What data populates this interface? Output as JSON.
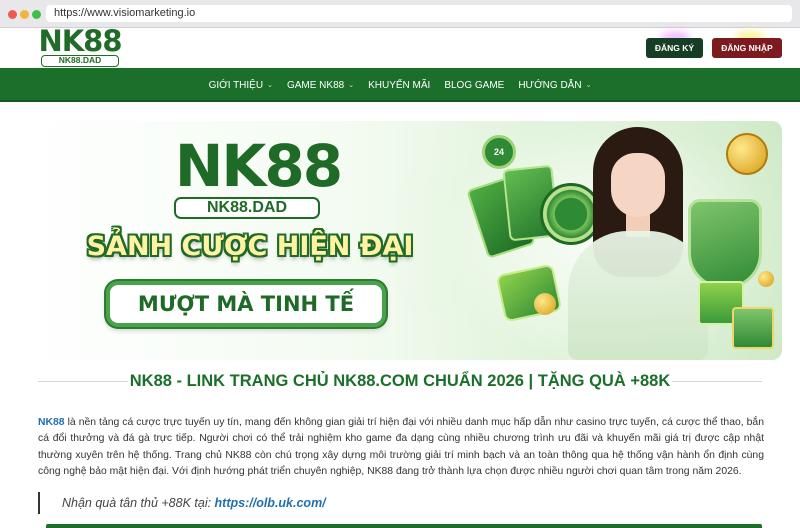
{
  "browser": {
    "url": "https://www.visiomarketing.io"
  },
  "header": {
    "logo_main": "NK88",
    "logo_sub": "NK88.DAD",
    "register_label": "ĐĂNG KÝ",
    "login_label": "ĐĂNG NHẬP"
  },
  "nav": {
    "items": [
      {
        "label": "GIỚI THIỆU",
        "dropdown": true
      },
      {
        "label": "GAME NK88",
        "dropdown": true
      },
      {
        "label": "KHUYẾN MÃI",
        "dropdown": false
      },
      {
        "label": "BLOG GAME",
        "dropdown": false
      },
      {
        "label": "HƯỚNG DẪN",
        "dropdown": true
      }
    ]
  },
  "banner": {
    "logo": "NK88",
    "logo_sub": "NK88.DAD",
    "slogan": "SẢNH CƯỢC HIỆN ĐẠI",
    "pill": "MƯỢT MÀ TINH TẾ",
    "clock_label": "24"
  },
  "article": {
    "heading": "NK88 - LINK TRANG CHỦ NK88.COM CHUẨN 2026 | TẶNG QUÀ +88K",
    "brand": "NK88",
    "paragraph": " là nền tảng cá cược trực tuyến uy tín, mang đến không gian giải trí hiện đại với nhiều danh mục hấp dẫn như casino trực tuyến, cá cược thể thao, bắn cá đổi thưởng và đá gà trực tiếp. Người chơi có thể trải nghiệm kho game đa dạng cùng nhiều chương trình ưu đãi và khuyến mãi giá trị được cập nhật thường xuyên trên hệ thống. Trang chủ NK88 còn chú trọng xây dựng môi trường giải trí minh bạch và an toàn thông qua hệ thống vận hành ổn định cùng công nghệ bảo mật hiện đại. Với định hướng phát triển chuyên nghiệp, NK88 đang trở thành lựa chọn được nhiều người chơi quan tâm trong năm 2026.",
    "quote_text": "Nhận quà tân thủ +88K tại: ",
    "quote_link": "https://olb.uk.com/"
  },
  "colors": {
    "brand_green": "#1c6e2b",
    "register_bg": "#163e24",
    "login_bg": "#7c1a1f",
    "link_blue": "#1f6fb0"
  }
}
